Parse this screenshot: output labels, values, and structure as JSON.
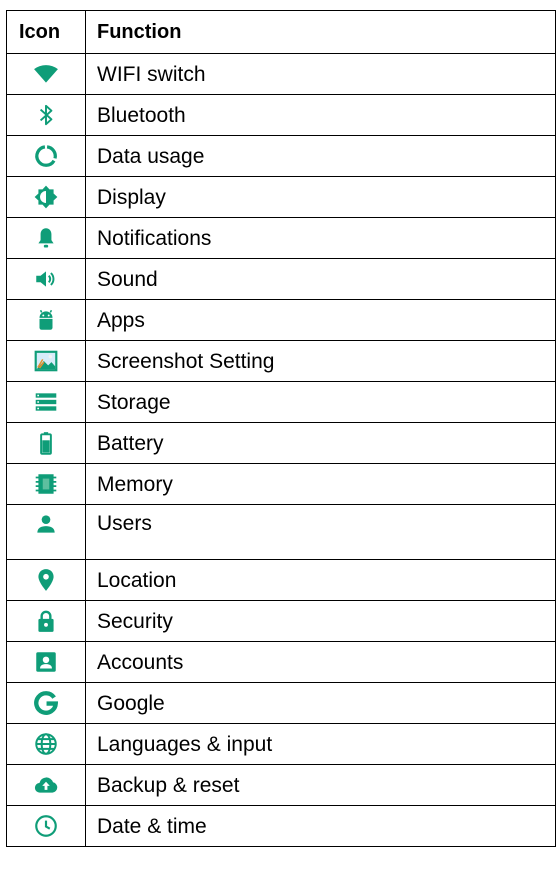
{
  "header": {
    "icon_col": "Icon",
    "function_col": "Function"
  },
  "accent_color": "#0f9d78",
  "rows": [
    {
      "icon": "wifi-icon",
      "label": "WIFI switch"
    },
    {
      "icon": "bluetooth-icon",
      "label": "Bluetooth"
    },
    {
      "icon": "data-usage-icon",
      "label": "Data usage"
    },
    {
      "icon": "display-brightness-icon",
      "label": "Display"
    },
    {
      "icon": "bell-icon",
      "label": "Notifications"
    },
    {
      "icon": "volume-icon",
      "label": "Sound"
    },
    {
      "icon": "android-icon",
      "label": "Apps"
    },
    {
      "icon": "screenshot-icon",
      "label": "Screenshot Setting"
    },
    {
      "icon": "storage-icon",
      "label": "Storage"
    },
    {
      "icon": "battery-icon",
      "label": "Battery"
    },
    {
      "icon": "memory-icon",
      "label": "Memory"
    },
    {
      "icon": "user-icon",
      "label": "Users"
    },
    {
      "icon": "location-pin-icon",
      "label": "Location"
    },
    {
      "icon": "lock-icon",
      "label": "Security"
    },
    {
      "icon": "account-box-icon",
      "label": "Accounts"
    },
    {
      "icon": "google-g-icon",
      "label": "Google"
    },
    {
      "icon": "globe-icon",
      "label": "Languages & input"
    },
    {
      "icon": "cloud-upload-icon",
      "label": "Backup & reset"
    },
    {
      "icon": "clock-icon",
      "label": "Date & time"
    }
  ]
}
